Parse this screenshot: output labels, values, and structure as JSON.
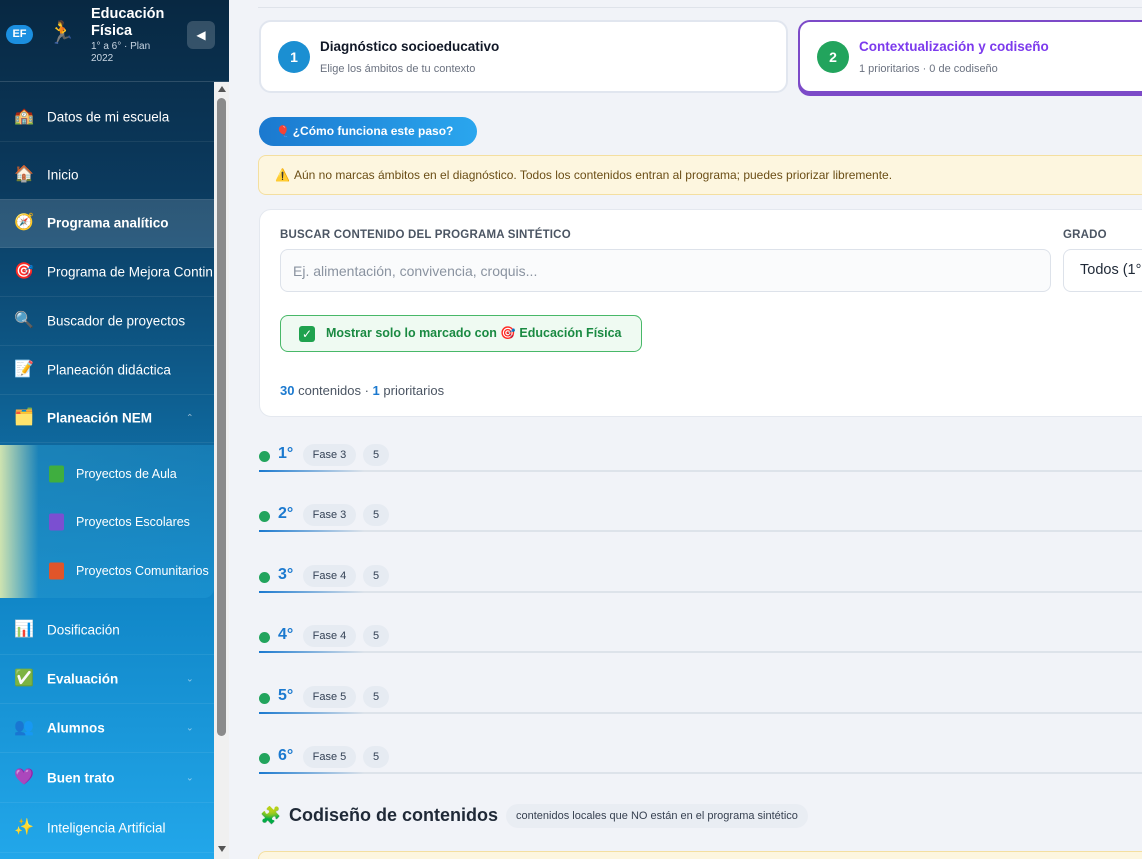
{
  "brand": {
    "badge": "EF",
    "title": "Educación Física",
    "subtitle": "1° a 6° · Plan 2022",
    "collapse_icon": "◀"
  },
  "sidebar": {
    "items": [
      {
        "label": "Datos de mi escuela",
        "icon": "🏫"
      },
      {
        "label": "Inicio",
        "icon": "🏠"
      },
      {
        "label": "Programa analítico",
        "icon": "🧭"
      },
      {
        "label": "Programa de Mejora Contin",
        "icon": "🎯"
      },
      {
        "label": "Buscador de proyectos",
        "icon": "🔍"
      },
      {
        "label": "Planeación didáctica",
        "icon": "📝"
      },
      {
        "label": "Planeación NEM",
        "icon": "🗂️"
      },
      {
        "label": "Dosificación",
        "icon": "📊"
      },
      {
        "label": "Evaluación",
        "icon": "✅"
      },
      {
        "label": "Alumnos",
        "icon": "👥"
      },
      {
        "label": "Buen trato",
        "icon": "💜"
      },
      {
        "label": "Inteligencia Artificial",
        "icon": "✨"
      }
    ],
    "submenu": [
      {
        "label": "Proyectos de Aula",
        "color": "#3fae3f"
      },
      {
        "label": "Proyectos Escolares",
        "color": "#7b4fd1"
      },
      {
        "label": "Proyectos Comunitarios",
        "color": "#e0552a"
      }
    ],
    "caret": "⌃",
    "caret_down": "⌄"
  },
  "steps": [
    {
      "number": "1",
      "title": "Diagnóstico socioeducativo",
      "subtitle": "Elige los ámbitos de tu contexto"
    },
    {
      "number": "2",
      "title": "Contextualización y codiseño",
      "subtitle": "1 prioritarios · 0 de codiseño"
    }
  ],
  "howto": {
    "icon": "🎈",
    "label": "¿Cómo funciona este paso?"
  },
  "alert": {
    "icon": "⚠️",
    "text": "Aún no marcas ámbitos en el diagnóstico. Todos los contenidos entran al programa; puedes priorizar libremente."
  },
  "search": {
    "label": "BUSCAR CONTENIDO DEL PROGRAMA SINTÉTICO",
    "placeholder": "Ej. alimentación, convivencia, croquis...",
    "grade_label": "GRADO",
    "grade_value": "Todos (1°"
  },
  "filter": {
    "checkbox": "✓",
    "text": "Mostrar solo lo marcado con 🎯 Educación Física"
  },
  "counts": {
    "contenidos": "30",
    "contenidos_label": "contenidos ·",
    "prioritarios": "1",
    "prioritarios_label": "prioritarios"
  },
  "grades": [
    {
      "grade": "1°",
      "phase": "Fase 3",
      "count": "5"
    },
    {
      "grade": "2°",
      "phase": "Fase 3",
      "count": "5"
    },
    {
      "grade": "3°",
      "phase": "Fase 4",
      "count": "5"
    },
    {
      "grade": "4°",
      "phase": "Fase 4",
      "count": "5"
    },
    {
      "grade": "5°",
      "phase": "Fase 5",
      "count": "5"
    },
    {
      "grade": "6°",
      "phase": "Fase 5",
      "count": "5"
    }
  ],
  "codesign": {
    "icon": "🧩",
    "title": "Codiseño de contenidos",
    "chip": "contenidos locales que NO están en el programa sintético"
  }
}
